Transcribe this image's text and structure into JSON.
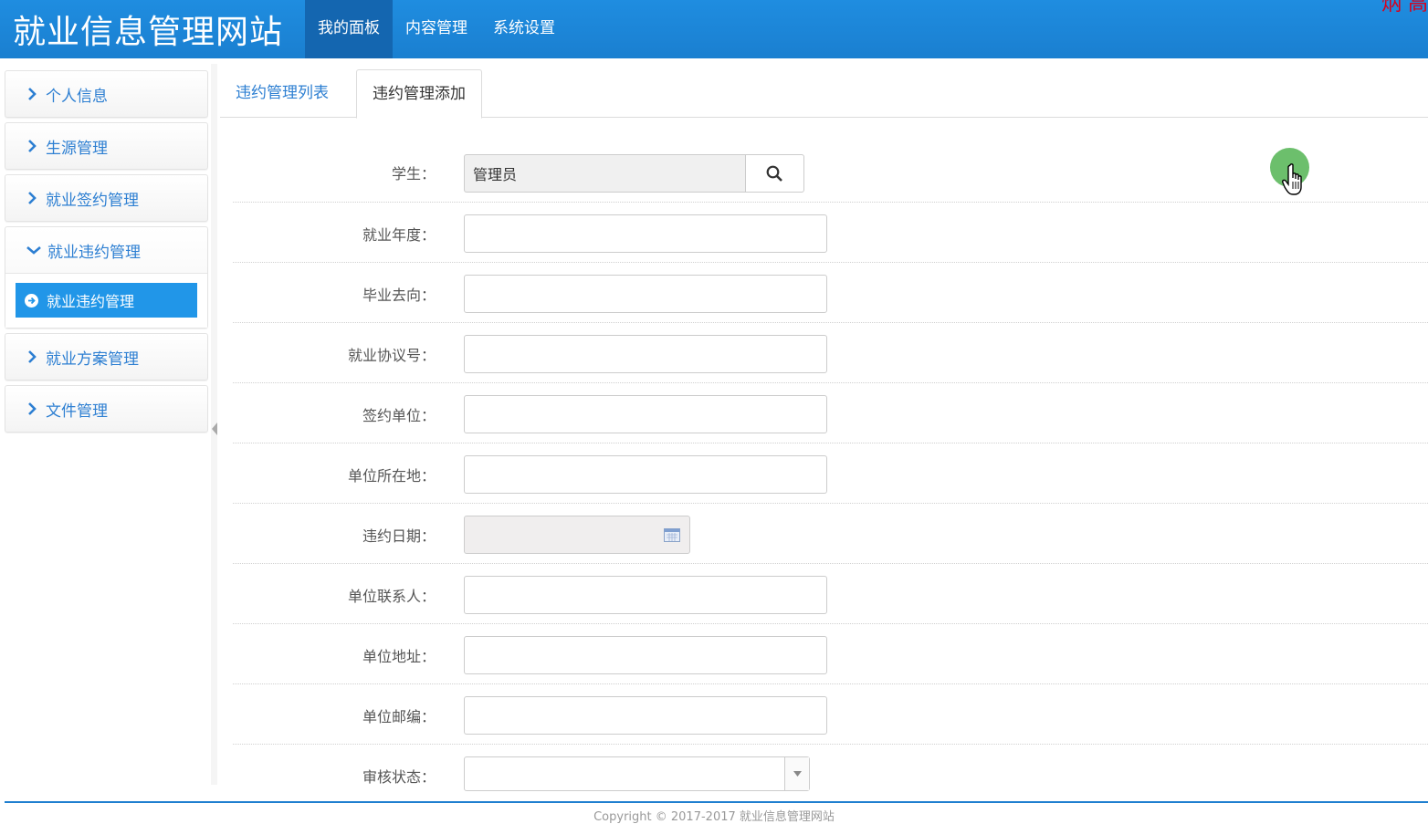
{
  "header": {
    "brand": "就业信息管理网站",
    "nav": [
      {
        "label": "我的面板",
        "active": true
      },
      {
        "label": "内容管理",
        "active": false
      },
      {
        "label": "系统设置",
        "active": false
      }
    ],
    "corner_text": "炳 高"
  },
  "sidebar": {
    "items": [
      {
        "label": "个人信息"
      },
      {
        "label": "生源管理"
      },
      {
        "label": "就业签约管理"
      },
      {
        "label": "就业违约管理",
        "open": true,
        "children": [
          {
            "label": "就业违约管理",
            "active": true
          }
        ]
      },
      {
        "label": "就业方案管理"
      },
      {
        "label": "文件管理"
      }
    ]
  },
  "tabs": [
    {
      "label": "违约管理列表",
      "active": false
    },
    {
      "label": "违约管理添加",
      "active": true
    }
  ],
  "form": {
    "student_label": "学生：",
    "student_value": "管理员",
    "year_label": "就业年度：",
    "destination_label": "毕业去向：",
    "agreement_label": "就业协议号：",
    "unit_label": "签约单位：",
    "location_label": "单位所在地：",
    "date_label": "违约日期：",
    "contact_label": "单位联系人：",
    "address_label": "单位地址：",
    "postcode_label": "单位邮编：",
    "status_label": "审核状态："
  },
  "footer": {
    "copyright": "Copyright © 2017-2017 就业信息管理网站"
  },
  "colors": {
    "header_bg": "#1f8de0",
    "nav_active": "#1466b0",
    "link_blue": "#2d7fd2",
    "sub_active": "#2196e8",
    "cursor_marker": "#5cb85c"
  }
}
